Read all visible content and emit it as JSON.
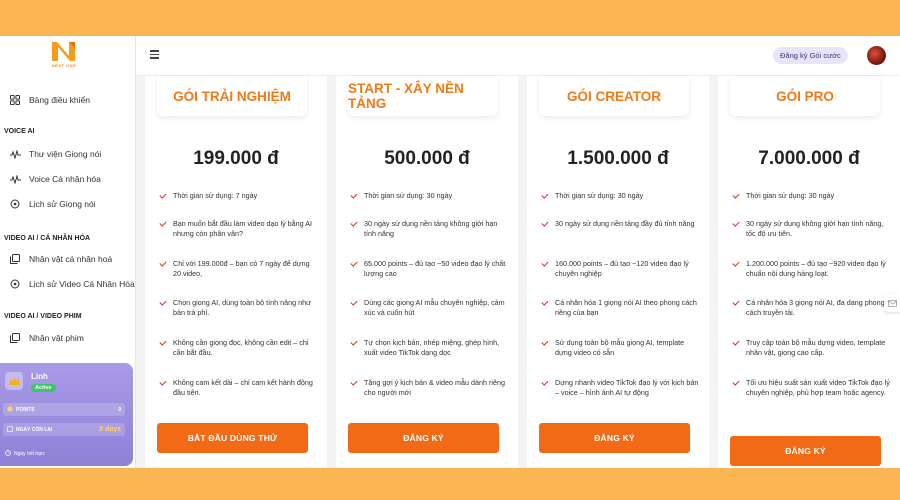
{
  "app": {
    "logo_text": "NEXT ONE"
  },
  "header": {
    "register_label": "Đăng ký Gói cước"
  },
  "sidebar": {
    "dashboard": "Bảng điều khiển",
    "section_voice": "VOICE AI",
    "voice_items": [
      "Thư viện Giọng nói",
      "Voice Cá nhân hóa",
      "Lịch sử Giọng nói"
    ],
    "section_video_personal": "VIDEO AI / CÁ NHÂN HÓA",
    "video_personal_items": [
      "Nhân vật cá nhân hoá",
      "Lịch sử Video Cá Nhân Hóa"
    ],
    "section_video_film": "VIDEO AI / VIDEO PHIM",
    "video_film_items": [
      "Nhân vật phim"
    ]
  },
  "user": {
    "name": "Linh",
    "status": "Active",
    "points_label": "POINTS",
    "points_value": "0",
    "days_label": "NGÀY CÒN LẠI",
    "days_value": "0 days",
    "expire_label": "Ngày hết hạn:"
  },
  "plans": [
    {
      "title": "GÓI TRẢI NGHIỆM",
      "price": "199.000 đ",
      "features": [
        "Thời gian sử dụng: 7 ngày",
        "Bạn muốn bắt đầu làm video dạo lý bằng AI nhưng còn phân vân?",
        "Chỉ với 199.000đ – bạn có 7 ngày để dựng 20 video,",
        "Chọn giọng AI, dùng toàn bộ tính năng như bản trả phí.",
        "Không cần giọng đọc, không cần edit – chỉ cần bắt đầu.",
        "Không cam kết dài – chỉ cam kết hành động đầu tiên."
      ],
      "button": "BẮT ĐẦU DÙNG THỬ"
    },
    {
      "title": "START - XÂY NỀN TẢNG",
      "price": "500.000 đ",
      "features": [
        "Thời gian sử dụng: 30 ngày",
        "30 ngày sử dụng nền tảng không giới hạn tính năng",
        "65.000 points – đủ tạo ~50 video đạo lý chất lượng cao",
        "Dùng các giọng AI mẫu chuyên nghiệp, cảm xúc và cuốn hút",
        "Tự chọn kịch bản, nhép miệng, ghép hình, xuất video TikTok dạng dọc",
        "Tặng gợi ý kịch bản & video mẫu dành riêng cho người mới"
      ],
      "button": "ĐĂNG KÝ"
    },
    {
      "title": "GÓI CREATOR",
      "price": "1.500.000 đ",
      "features": [
        "Thời gian sử dụng: 30 ngày",
        "30 ngày sử dụng nền tảng đầy đủ tính năng",
        "160.000 points – đủ tạo ~120 video đạo lý chuyên nghiệp",
        "Cá nhân hóa 1 giọng nói AI theo phong cách riêng của bạn",
        "Sử dụng toàn bộ mẫu giọng AI, template dựng video có sẵn",
        "Dựng nhanh video TikTok đạo lý với kịch bản – voice – hình ảnh AI tự động"
      ],
      "button": "ĐĂNG KÝ"
    },
    {
      "title": "GÓI PRO",
      "price": "7.000.000 đ",
      "features": [
        "Thời gian sử dụng: 30 ngày",
        "30 ngày sử dụng không giới hạn tính năng, tốc độ ưu tiên.",
        "1.200.000 points – đủ tạo ~920 video đạo lý chuẩn nội dung hàng loạt.",
        "Cá nhân hóa 3 giọng nói AI, đa dạng phong cách truyền tải.",
        "Truy cập toàn bộ mẫu dựng video, template nhân vật, giọng cao cấp.",
        "Tối ưu hiệu suất sản xuất video TikTok đạo lý chuyên nghiệp, phù hợp team hoặc agency."
      ],
      "button": "ĐĂNG KÝ"
    }
  ]
}
